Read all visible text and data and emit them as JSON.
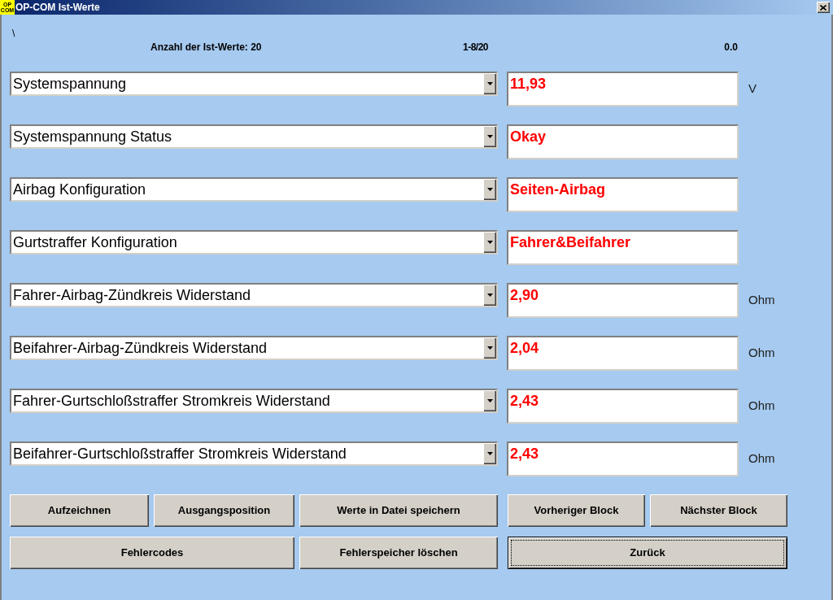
{
  "window": {
    "title": "OP-COM Ist-Werte",
    "logo_lines": [
      "OP",
      "COM"
    ]
  },
  "header": {
    "path": "\\",
    "count": "Anzahl der Ist-Werte: 20",
    "range": "1-8/20",
    "time": "0.0"
  },
  "parameters": [
    {
      "name": "Systemspannung",
      "value": "11,93",
      "unit": "V"
    },
    {
      "name": "Systemspannung Status",
      "value": "Okay"
    },
    {
      "name": "Airbag Konfiguration",
      "value": "Seiten-Airbag"
    },
    {
      "name": "Gurtstraffer Konfiguration",
      "value": "Fahrer&Beifahrer"
    },
    {
      "name": "Fahrer-Airbag-Zündkreis Widerstand",
      "value": "2,90",
      "unit": "Ohm"
    },
    {
      "name": "Beifahrer-Airbag-Zündkreis Widerstand",
      "value": "2,04",
      "unit": "Ohm"
    },
    {
      "name": "Fahrer-Gurtschloßstraffer Stromkreis Widerstand",
      "value": "2,43",
      "unit": "Ohm"
    },
    {
      "name": "Beifahrer-Gurtschloßstraffer Stromkreis Widerstand",
      "value": "2,43",
      "unit": "Ohm"
    }
  ],
  "button_rows": [
    [
      {
        "label": "Aufzeichnen",
        "default": false
      },
      {
        "label": "Ausgangsposition",
        "default": false
      },
      {
        "label": "Werte in Datei speichern",
        "default": false
      },
      {
        "label": "Vorheriger Block",
        "default": false
      },
      {
        "label": "Nächster Block",
        "default": false
      }
    ],
    [
      {
        "label": "Fehlercodes",
        "default": false
      },
      {
        "label": "Fehlerspeicher löschen",
        "default": false
      },
      {
        "label": "Zurück",
        "default": true
      }
    ]
  ]
}
